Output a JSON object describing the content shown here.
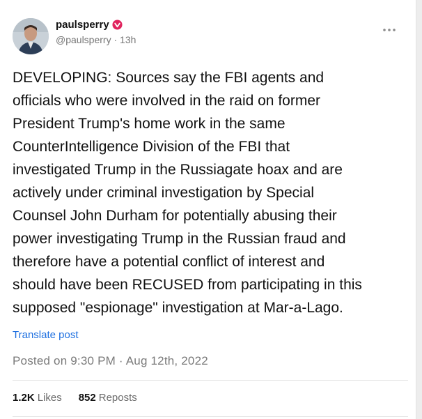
{
  "post": {
    "author": {
      "username": "paulsperry",
      "handle": "@paulsperry",
      "time": "13h",
      "separator": "·",
      "verified_icon": "verified-badge-icon",
      "badge_color": "#e0245e"
    },
    "text": "DEVELOPING: Sources say the FBI agents and\nofficials who were involved in the raid on former\nPresident Trump's home work in the same\nCounterIntelligence Division of the FBI that\ninvestigated Trump in the Russiagate hoax and are\nactively under criminal investigation by Special\nCounsel John Durham for potentially abusing their\npower investigating Trump in the Russian fraud and\ntherefore have a potential conflict of interest and\nshould have been RECUSED from participating in this\nsupposed \"espionage\" investigation at Mar-a-Lago.",
    "translate_label": "Translate post",
    "posted_on": "Posted on 9:30 PM · Aug 12th, 2022",
    "likes_count": "1.2K",
    "likes_label": "Likes",
    "reposts_count": "852",
    "reposts_label": "Reposts",
    "link_color": "#1d6fe0"
  }
}
